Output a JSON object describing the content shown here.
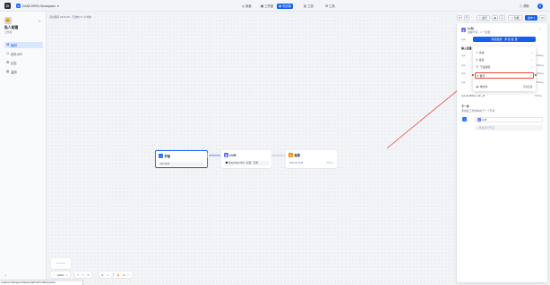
{
  "topbar": {
    "logo": "D",
    "workspace_badge": "D",
    "workspace_name": "DANZ1990's Workspace",
    "workspace_chevron": "chevron-down-icon",
    "nav": [
      {
        "label": "探索",
        "icon": "compass-icon",
        "active": false
      },
      {
        "label": "工作室",
        "icon": "grid-icon",
        "active": false
      },
      {
        "label": "知识库",
        "icon": "book-icon",
        "active": true
      },
      {
        "label": "工具",
        "icon": "tool-icon",
        "active": false
      }
    ],
    "help_label": "帮助",
    "avatar": "D"
  },
  "sidebar": {
    "app_icon": "🐱",
    "app_name": "私人助理",
    "app_type": "工作流",
    "items": [
      {
        "label": "编排",
        "icon": "terminal-icon",
        "active": true
      },
      {
        "label": "访问 API",
        "icon": "api-icon",
        "active": false
      },
      {
        "label": "日志",
        "icon": "log-icon",
        "active": false
      },
      {
        "label": "监测",
        "icon": "chart-icon",
        "active": false
      }
    ]
  },
  "canvas": {
    "breadcrumb": "自动保存 23:51:36 · 已发布 17 小时前",
    "toolbar": {
      "run": "运行",
      "preview": "功能",
      "publish": "发布"
    },
    "nodes": {
      "start": {
        "title": "开始",
        "icon_color": "#2970ff",
        "row": "sys.input",
        "row_tail": "..."
      },
      "llm": {
        "title": "LLM",
        "icon_color": "#6172f3",
        "row": "deepseek-chat · 对话 · 引用"
      },
      "end": {
        "title": "结束",
        "icon_color": "#f79009",
        "row_label": "text",
        "row_value": "{x} LLM",
        "row_type": "String"
      }
    }
  },
  "zoom": {
    "value": "100%"
  },
  "panel": {
    "title": "LLM",
    "subtitle": "选择节点 · 1 个变量",
    "button": "添加变量 · 添 加 变 量",
    "section_input": "输入变量",
    "dropdown": [
      {
        "label": "文本",
        "icon": "text-icon"
      },
      {
        "label": "段落",
        "icon": "paragraph-icon"
      },
      {
        "label": "下拉选项",
        "icon": "select-icon"
      },
      {
        "label": "数字",
        "icon": "number-icon",
        "highlighted": true
      },
      {
        "label": "单文件",
        "icon": "file-icon"
      }
    ],
    "dropdown_hint": "添加变量",
    "side_labels": [
      "sys.",
      "sys.",
      "sys.",
      "sys."
    ],
    "side_types": [
      "String",
      "String",
      "String",
      "String"
    ],
    "sys_row": "sys.workflow_run_id",
    "sys_row_type": "String",
    "next_title": "下一步",
    "next_hint": "添加此工作流中的下一个节点",
    "next_node": "LLM",
    "next_add": "+ 添加并行节点"
  },
  "statusbar": {
    "text": "localhost:3000/app/1e5b0e2f-9a83-4d70-b8f5/workflow"
  },
  "colors": {
    "accent": "#155eef",
    "annotation": "#f04438"
  }
}
